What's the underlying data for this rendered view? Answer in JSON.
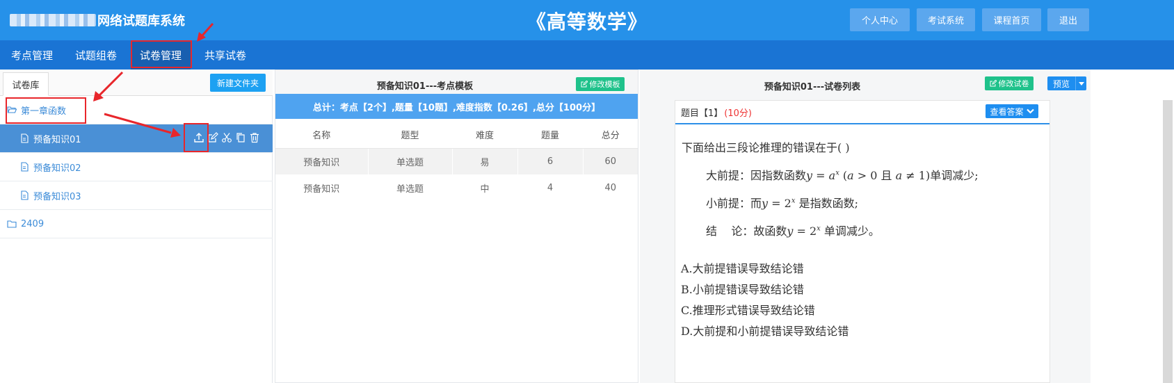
{
  "header": {
    "system_name": "网络试题库系统",
    "course_title": "《高等数学》",
    "buttons": [
      "个人中心",
      "考试系统",
      "课程首页",
      "退出"
    ]
  },
  "nav": {
    "items": [
      "考点管理",
      "试题组卷",
      "试卷管理",
      "共享试卷"
    ],
    "active": "试卷管理"
  },
  "left_panel": {
    "tab_label": "试卷库",
    "new_folder_label": "新建文件夹",
    "tree": [
      {
        "type": "folder-open",
        "label": "第一章函数"
      },
      {
        "type": "file",
        "label": "预备知识01",
        "selected": true
      },
      {
        "type": "file",
        "label": "预备知识02"
      },
      {
        "type": "file",
        "label": "预备知识03"
      },
      {
        "type": "folder",
        "label": "2409"
      }
    ],
    "row_action_icons": [
      "upload-icon",
      "edit-icon",
      "cut-icon",
      "copy-icon",
      "delete-icon"
    ]
  },
  "middle_panel": {
    "title": "预备知识01---考点模板",
    "edit_button": "修改模板",
    "summary": "总计：考点【2个】,题量【10题】,难度指数【0.26】,总分【100分】",
    "columns": [
      "名称",
      "题型",
      "难度",
      "题量",
      "总分"
    ],
    "rows": [
      [
        "预备知识",
        "单选题",
        "易",
        "6",
        "60"
      ],
      [
        "预备知识",
        "单选题",
        "中",
        "4",
        "40"
      ]
    ]
  },
  "right_panel": {
    "title": "预备知识01---试卷列表",
    "edit_button": "修改试卷",
    "preview_button": "预览",
    "question": {
      "header_label": "题目【1】",
      "score": "(10分)",
      "answer_button": "查看答案",
      "stem": "下面给出三段论推理的错误在于(    )",
      "premise_major": "大前提：因指数函数",
      "premise_major_tail": "单调减少;",
      "premise_minor": "小前提：而",
      "premise_minor_tail": "是指数函数;",
      "conclusion": "结    论：故函数",
      "conclusion_tail": "单调减少。",
      "options": [
        "A.大前提错误导致结论错",
        "B.小前提错误导致结论错",
        "C.推理形式错误导致结论错",
        "D.大前提和小前提错误导致结论错"
      ]
    }
  },
  "colors": {
    "header": "#2691e9",
    "nav": "#1a74d4",
    "selected_row": "#4a90d6",
    "green_button": "#1fc28b",
    "annotation_red": "#e8262b"
  }
}
